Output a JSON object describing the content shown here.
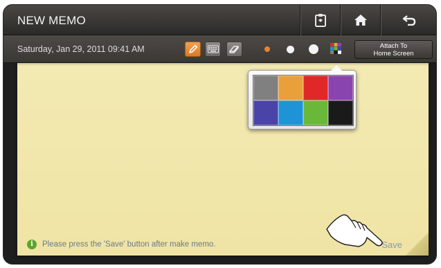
{
  "titlebar": {
    "title": "NEW MEMO",
    "buttons": [
      {
        "name": "clipboard-icon"
      },
      {
        "name": "home-icon"
      },
      {
        "name": "back-icon"
      }
    ]
  },
  "toolbar": {
    "date": "Saturday, Jan 29, 2011 09:41 AM",
    "tools": [
      "pen-icon",
      "keyboard-icon",
      "eraser-icon"
    ],
    "pen_sizes": [
      "small",
      "medium",
      "large"
    ],
    "selected_pen_color": "#e8842a",
    "attach_label": "Attach To\nHome Screen"
  },
  "palette": {
    "colors": [
      "#808080",
      "#e9a03a",
      "#e02828",
      "#8a44b0",
      "#4a44a8",
      "#1e94d6",
      "#6ab83a",
      "#1a1a1a"
    ]
  },
  "memo": {
    "paper_color": "#f1e7ab",
    "info_text": "Please press the 'Save' button after make memo.",
    "save_label": "Save"
  }
}
